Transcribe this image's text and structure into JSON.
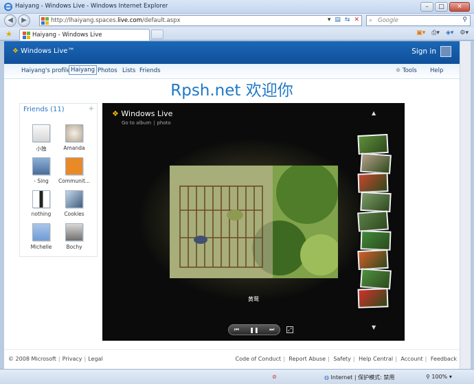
{
  "browser": {
    "window_title": "Haiyang - Windows Live - Windows Internet Explorer",
    "url_prefix": "http://lhaiyang.spaces.",
    "url_domain": "live.com",
    "url_suffix": "/default.aspx",
    "search_placeholder": "Google",
    "tab_label": "Haiyang - Windows Live"
  },
  "header": {
    "logo": "Windows Live™",
    "sign_in": "Sign in"
  },
  "subnav": {
    "items": [
      "Haiyang's profile",
      "Haiyang",
      "Photos",
      "Lists",
      "Friends"
    ],
    "selected": "Haiyang",
    "tools": "Tools",
    "help": "Help"
  },
  "space_title": "Rpsh.net 欢迎你",
  "friends": {
    "title": "Friends (11)",
    "items": [
      "小独",
      "Amanda",
      "- Sing",
      "Communit...",
      "nothing",
      "Cookies",
      "Michelle",
      "Bochy"
    ]
  },
  "viewer": {
    "logo": "Windows Live",
    "sub_links": [
      "Go to album",
      "photo"
    ],
    "caption": "黄莺",
    "thumb_colors": [
      "#5f8f3c",
      "#b5a08a",
      "#c8462e",
      "#7d9a6b",
      "#5c7f4a",
      "#3e8a3a",
      "#d65d2a",
      "#4e9040",
      "#d4302a"
    ]
  },
  "footer": {
    "copyright": "© 2008 Microsoft",
    "left_links": [
      "Privacy",
      "Legal"
    ],
    "right_links": [
      "Code of Conduct",
      "Report Abuse",
      "Safety",
      "Help Central",
      "Account",
      "Feedback"
    ]
  },
  "status": {
    "zone": "Internet | 保护模式: 禁用",
    "zoom": "100%"
  }
}
